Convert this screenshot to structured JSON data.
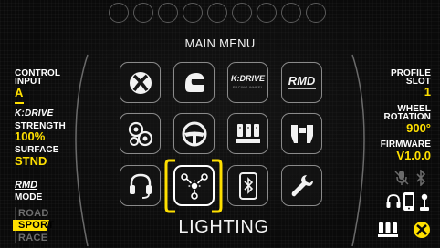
{
  "header": {
    "title": "MAIN MENU"
  },
  "left_panel": {
    "control_input": {
      "label": "CONTROL INPUT",
      "label_line1": "CONTROL",
      "label_line2": "INPUT",
      "value": "A"
    },
    "kdrive_logo": "K:DRIVE",
    "strength": {
      "label": "STRENGTH",
      "value": "100%"
    },
    "surface": {
      "label": "SURFACE",
      "value": "STND"
    },
    "mode": {
      "logo": "RMD",
      "label": "MODE",
      "options": [
        "ROAD",
        "SPORT",
        "RACE"
      ],
      "selected": "SPORT"
    }
  },
  "right_panel": {
    "profile_slot": {
      "label_line1": "PROFILE",
      "label_line2": "SLOT",
      "value": "1"
    },
    "wheel_rotation": {
      "label_line1": "WHEEL",
      "label_line2": "ROTATION",
      "value": "900°"
    },
    "firmware": {
      "label": "FIRMWARE",
      "value": "V1.0.0"
    },
    "status_icons": [
      "muted-mic-icon",
      "bluetooth-icon",
      "headset-icon",
      "phone-icon",
      "shifter-icon",
      "pedals-icon",
      "xbox-icon"
    ]
  },
  "menu": {
    "tiles": [
      {
        "icon": "xbox-icon"
      },
      {
        "icon": "helmet-icon"
      },
      {
        "icon": "kdrive-icon",
        "text": "K:DRIVE",
        "subtext": "RACING WHEEL"
      },
      {
        "icon": "rmd-icon",
        "text": "RMD"
      },
      {
        "icon": "gears-icon"
      },
      {
        "icon": "steering-wheel-icon"
      },
      {
        "icon": "pedals-icon"
      },
      {
        "icon": "paddles-icon"
      },
      {
        "icon": "headset-icon"
      },
      {
        "icon": "lighting-icon"
      },
      {
        "icon": "phone-bluetooth-icon"
      },
      {
        "icon": "wrench-icon"
      }
    ],
    "selected_label": "LIGHTING"
  },
  "colors": {
    "accent": "#ffe000",
    "background": "#0a0a0a",
    "tile_border": "#8a8a8a",
    "led_ring": "#5a5a5a"
  }
}
